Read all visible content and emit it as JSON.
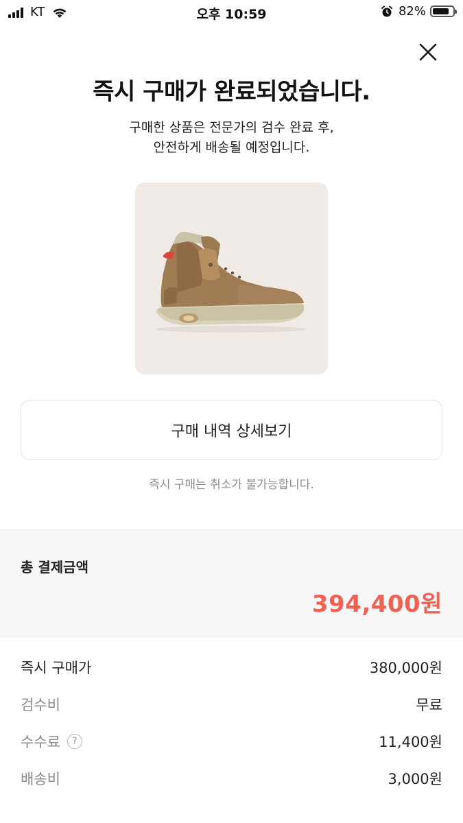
{
  "status_bar": {
    "carrier": "KT",
    "time": "오후 10:59",
    "battery_percent": "82%",
    "battery_level": 0.82
  },
  "header": {
    "close_icon": "close-icon",
    "title": "즉시 구매가 완료되었습니다.",
    "subtitle_line1": "구매한 상품은 전문가의 검수 완료 후,",
    "subtitle_line2": "안전하게 배송될 예정입니다."
  },
  "product": {
    "image": "sneaker-image"
  },
  "actions": {
    "detail_button_label": "구매 내역 상세보기",
    "notice": "즉시 구매는 취소가 불가능합니다."
  },
  "total": {
    "label": "총 결제금액",
    "amount": "394,400원"
  },
  "breakdown": [
    {
      "label": "즉시 구매가",
      "value": "380,000원"
    },
    {
      "label": "검수비",
      "value": "무료"
    },
    {
      "label": "수수료",
      "value": "11,400원",
      "help_icon": "?"
    },
    {
      "label": "배송비",
      "value": "3,000원"
    }
  ],
  "colors": {
    "accent": "#ef6253",
    "product_bg": "#f1ebe7",
    "section_bg": "#f7f7f7"
  }
}
